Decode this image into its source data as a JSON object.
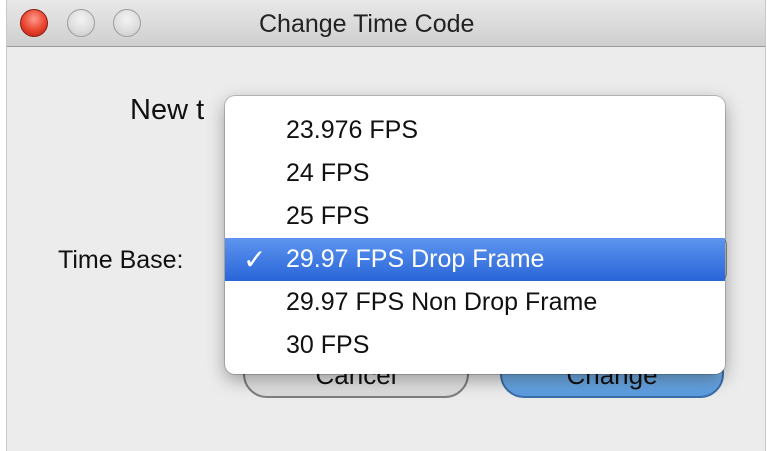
{
  "window": {
    "title": "Change Time Code"
  },
  "dialog": {
    "prompt_partial": "New t",
    "time_base_label": "Time Base:",
    "cancel_label": "Cancel",
    "change_label": "Change"
  },
  "popup_menu": {
    "check_mark": "✓",
    "selected_index": 3,
    "items": [
      {
        "label": "23.976 FPS"
      },
      {
        "label": "24 FPS"
      },
      {
        "label": "25 FPS"
      },
      {
        "label": "29.97 FPS Drop Frame"
      },
      {
        "label": "29.97 FPS Non Drop Frame"
      },
      {
        "label": "30 FPS"
      }
    ]
  },
  "colors": {
    "selection_highlight": "#2965d8",
    "close_button": "#e8432e",
    "default_button": "#72aee8"
  }
}
